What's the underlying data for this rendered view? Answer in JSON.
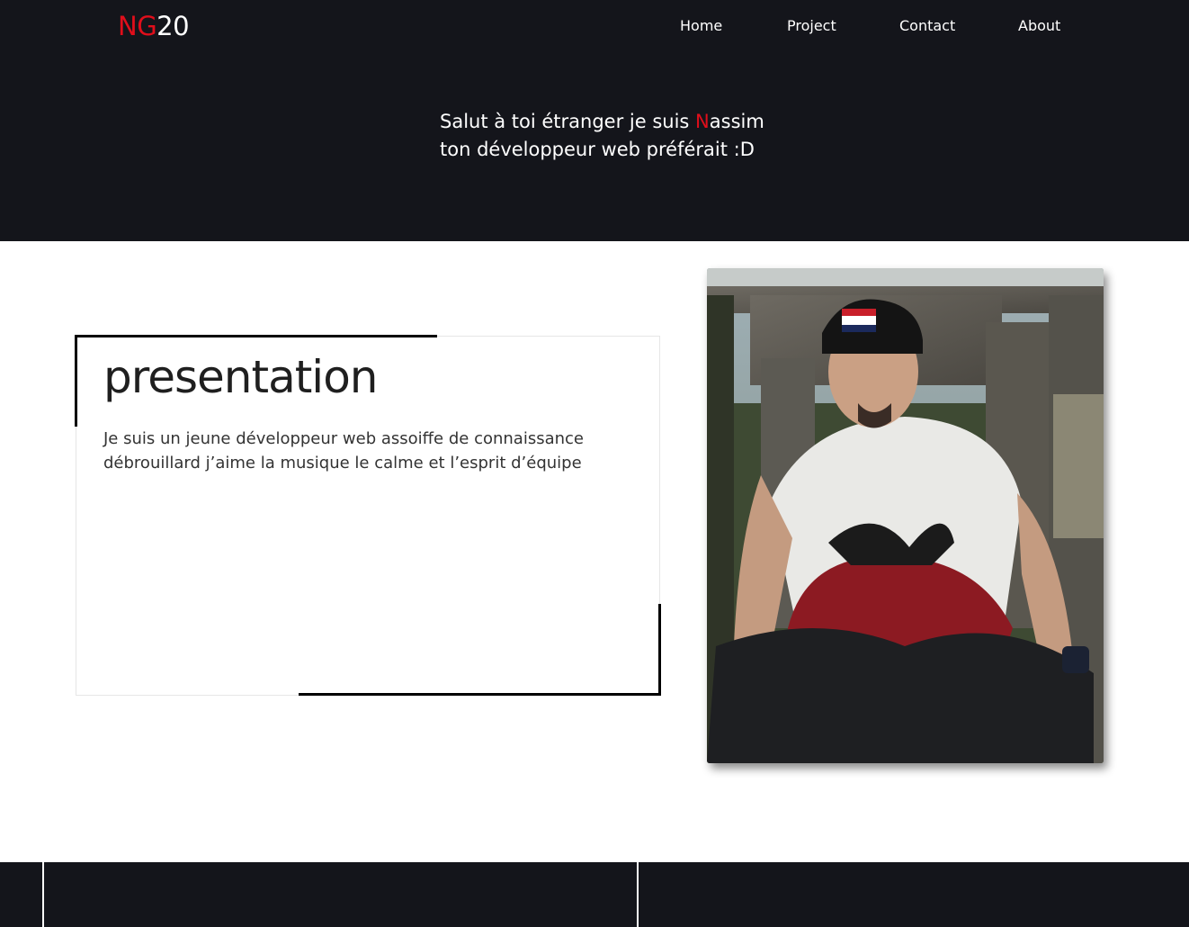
{
  "header": {
    "logo": {
      "prefix": "NG",
      "suffix": "20"
    },
    "nav": [
      {
        "label": "Home"
      },
      {
        "label": "Project"
      },
      {
        "label": "Contact"
      },
      {
        "label": "About"
      }
    ]
  },
  "hero": {
    "line1_before": "Salut à toi étranger je suis ",
    "line1_highlight": "N",
    "line1_after": "assim",
    "line2": "ton développeur web préférait :D"
  },
  "presentation": {
    "title": "presentation",
    "line1": "Je suis un jeune développeur web assoiffe de connaissance",
    "line2": "débrouillard j’aime la musique le calme et l’esprit d’équipe"
  },
  "colors": {
    "dark_bg": "#14151b",
    "accent_red": "#e00e1b",
    "text_dark": "#1f1f1f"
  },
  "icons": {
    "profile_photo": "portrait-photo"
  }
}
